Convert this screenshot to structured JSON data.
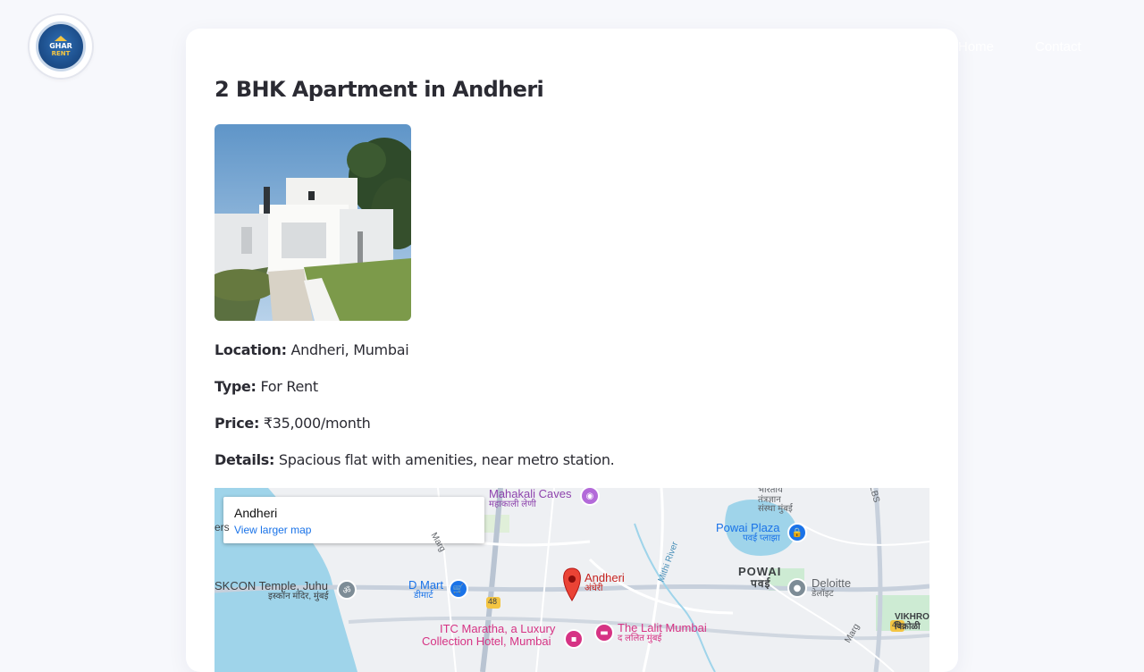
{
  "brand": {
    "logo_line1": "GHAR",
    "logo_line2": "RENT"
  },
  "nav": {
    "item1": "Home",
    "item2": "Contact"
  },
  "listing": {
    "title": "2 BHK Apartment in Andheri",
    "location_label": "Location:",
    "location_value": "Andheri, Mumbai",
    "type_label": "Type:",
    "type_value": "For Rent",
    "price_label": "Price:",
    "price_value": "₹35,000/month",
    "details_label": "Details:",
    "details_value": "Spacious flat with amenities, near metro station."
  },
  "map": {
    "place_name": "Andheri",
    "larger_map_link": "View larger map",
    "labels": {
      "mahakali": "Mahakali Caves",
      "mahakali_mr": "महाकाली लेणी",
      "iskcon": "SKCON Temple, Juhu",
      "iskcon_mr": "इस्कॉन मंदिर, मुंबई",
      "dmart": "D Mart",
      "dmart_mr": "डीमार्ट",
      "andheri": "Andheri",
      "andheri_mr": "अंधेरी",
      "mithi": "Mithi River",
      "powai_plaza": "Powai Plaza",
      "powai_plaza_mr": "पवई प्लाझा",
      "powai": "POWAI",
      "powai_mr": "पवई",
      "deloitte": "Deloitte",
      "deloitte_mr": "डेलॉइट",
      "bharatiya": "भारतीय",
      "bharatiya2": "तंत्रज्ञान",
      "bharatiya3": "संस्था मुंबई",
      "itc": "ITC Maratha, a Luxury",
      "itc2": "Collection Hotel, Mumbai",
      "lalit": "The Lalit Mumbai",
      "lalit_mr": "द ललित मुंबई",
      "vikhroli": "VIKHRO",
      "vikhroli_mr": "विक्रोळी",
      "road48a": "48",
      "road48b": "48",
      "marg": "Marg",
      "marg2": "Marg",
      "lbs": "LBS",
      "ers": "ers"
    }
  }
}
